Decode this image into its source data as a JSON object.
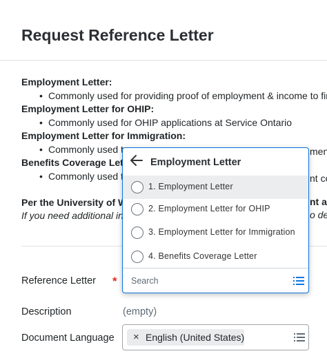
{
  "page": {
    "title": "Request Reference Letter"
  },
  "info": {
    "items": [
      {
        "heading": "Employment Letter:",
        "bullet": "Commonly used for providing proof of employment & income to fin"
      },
      {
        "heading": "Employment Letter for OHIP:",
        "bullet": "Commonly used for OHIP applications at Service Ontario"
      },
      {
        "heading": "Employment Letter for Immigration:",
        "bullet": "Commonly used t"
      },
      {
        "heading": "Benefits Coverage Lette",
        "bullet": "Commonly used t"
      }
    ],
    "bullet_right_fragments": [
      "ment",
      "nt cov"
    ]
  },
  "policy": {
    "bold_line": "Per the University of Wa",
    "bold_right": "nt ar",
    "italic_line": "If you need additional in",
    "italic_right": "o de"
  },
  "form": {
    "reference_letter_label": "Reference Letter",
    "required_mark": "*",
    "description_label": "Description",
    "description_value": "(empty)",
    "document_language_label": "Document Language",
    "language_selected": "English (United States)",
    "remove_glyph": "×"
  },
  "popup": {
    "title": "Employment Letter",
    "options": [
      "1. Employment Letter",
      "2. Employment Letter for OHIP",
      "3. Employment Letter for Immigration",
      "4. Benefits Coverage Letter"
    ],
    "highlighted_index": 0,
    "search_placeholder": "Search"
  },
  "colors": {
    "accent": "#0875e1",
    "required": "#de2e21",
    "highlight": "#ecedef",
    "divider": "#dfe2e6"
  },
  "icons": {
    "back": "arrow-left-icon",
    "list": "list-icon",
    "remove": "close-icon"
  }
}
